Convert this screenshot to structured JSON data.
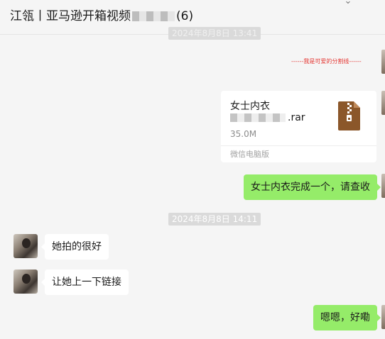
{
  "header": {
    "title_prefix": "江瓴丨亚马逊开箱视频",
    "title_suffix": "(6)"
  },
  "messages": {
    "timestamp_top": "2024年8月8日 13:41",
    "separator": "------我是可爱的分割线------",
    "file": {
      "name": "女士内衣",
      "ext": ".rar",
      "size": "35.0M",
      "source": "微信电脑版",
      "icon": "zip-archive-icon",
      "icon_color": "#8b572a"
    },
    "out_1": "女士内衣完成一个，请查收",
    "timestamp_mid": "2024年8月8日 14:11",
    "in_1": "她拍的很好",
    "in_2": "让她上一下链接",
    "out_2": "嗯嗯，好嘞"
  },
  "colors": {
    "background": "#f5f5f5",
    "self_bubble": "#95ec69",
    "other_bubble": "#ffffff",
    "separator_red": "#e53935"
  }
}
